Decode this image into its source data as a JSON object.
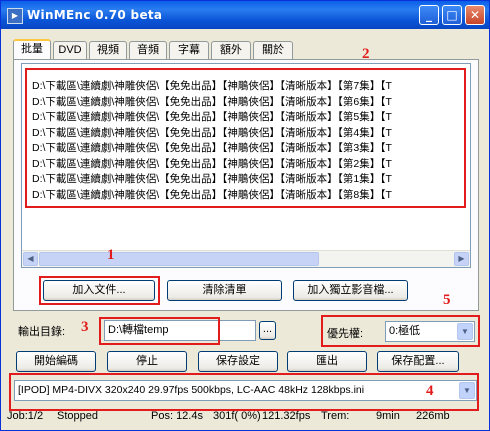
{
  "window": {
    "title": "WinMEnc 0.70 beta",
    "icon": "app-icon"
  },
  "titlebar": {
    "minimize": "_",
    "maximize": "□",
    "close": "✕"
  },
  "tabs": [
    "批量",
    "DVD",
    "視頻",
    "音頻",
    "字幕",
    "額外",
    "關於"
  ],
  "active_tab": "批量",
  "file_list": [
    "D:\\下載區\\連續劇\\神雕俠侶\\【免免出品】【神鵰俠侶】【清晰版本】【第7集】【T",
    "D:\\下載區\\連續劇\\神雕俠侶\\【免免出品】【神鵰俠侶】【清晰版本】【第6集】【T",
    "D:\\下載區\\連續劇\\神雕俠侶\\【免免出品】【神鵰俠侶】【清晰版本】【第5集】【T",
    "D:\\下載區\\連續劇\\神雕俠侶\\【免免出品】【神鵰俠侶】【清晰版本】【第4集】【T",
    "D:\\下載區\\連續劇\\神雕俠侶\\【免免出品】【神鵰俠侶】【清晰版本】【第3集】【T",
    "D:\\下載區\\連續劇\\神雕俠侶\\【免免出品】【神鵰俠侶】【清晰版本】【第2集】【T",
    "D:\\下載區\\連續劇\\神雕俠侶\\【免免出品】【神鵰俠侶】【清晰版本】【第1集】【T",
    "D:\\下載區\\連續劇\\神雕俠侶\\【免免出品】【神鵰俠侶】【清晰版本】【第8集】【T"
  ],
  "scroll": {
    "left": "◀",
    "right": "▶"
  },
  "list_buttons": {
    "add_file": "加入文件...",
    "clear_list": "清除清單",
    "add_separate": "加入獨立影音檔..."
  },
  "output": {
    "label": "輸出目錄:",
    "value": "D:\\轉檔temp",
    "browse": "..."
  },
  "priority": {
    "label": "優先權:",
    "value": "0:極低"
  },
  "actions": {
    "start": "開始編碼",
    "stop": "停止",
    "save_settings": "保存設定",
    "export": "匯出",
    "save_config": "保存配置..."
  },
  "profile": {
    "value": "[IPOD] MP4-DIVX 320x240 29.97fps 500kbps, LC-AAC 48kHz 128kbps.ini"
  },
  "dropdown_arrow": "▼",
  "status": {
    "job": "Job:1/2",
    "state": "Stopped",
    "pos": "Pos: 12.4s",
    "frames": "301f( 0%)",
    "fps": "121.32fps",
    "trem": "Trem:",
    "remaining": "9min",
    "size": "226mb"
  },
  "annotations": {
    "n1": "1",
    "n2": "2",
    "n3": "3",
    "n4": "4",
    "n5": "5"
  },
  "colors": {
    "titlebar": "#0a54d6",
    "annotation": "#e21c1c",
    "face": "#ece9d8"
  }
}
